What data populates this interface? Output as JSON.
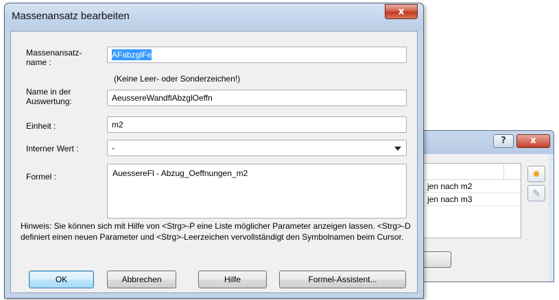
{
  "background_window": {
    "help_label": "?",
    "close_label": "x",
    "rows": [
      "jen nach m2",
      "jen nach m3"
    ]
  },
  "dialog": {
    "title": "Massenansatz bearbeiten",
    "close_label": "x",
    "fields": {
      "massenansatzname": {
        "label": "Massenansatz-\nname :",
        "value": "AFabzglFe"
      },
      "name_hint": "(Keine Leer- oder Sonderzeichen!)",
      "auswertung": {
        "label": "Name in der\nAuswertung:",
        "value": "AeussereWandflAbzglOeffn"
      },
      "einheit": {
        "label": "Einheit :",
        "value": "m2"
      },
      "interner_wert": {
        "label": "Interner Wert :",
        "value": "-"
      },
      "formel": {
        "label": "Formel :",
        "value": "AuessereFl - Abzug_Oeffnungen_m2"
      }
    },
    "hint": "Hinweis: Sie können sich mit Hilfe von <Strg>-P eine Liste möglicher Parameter anzeigen lassen.  <Strg>-D definiert einen neuen Parameter und <Strg>-Leerzeichen vervollständigt den Symbolnamen beim Cursor.",
    "buttons": {
      "ok": "OK",
      "cancel": "Abbrechen",
      "help": "Hilfe",
      "formula_assistant": "Formel-Assistent..."
    }
  }
}
